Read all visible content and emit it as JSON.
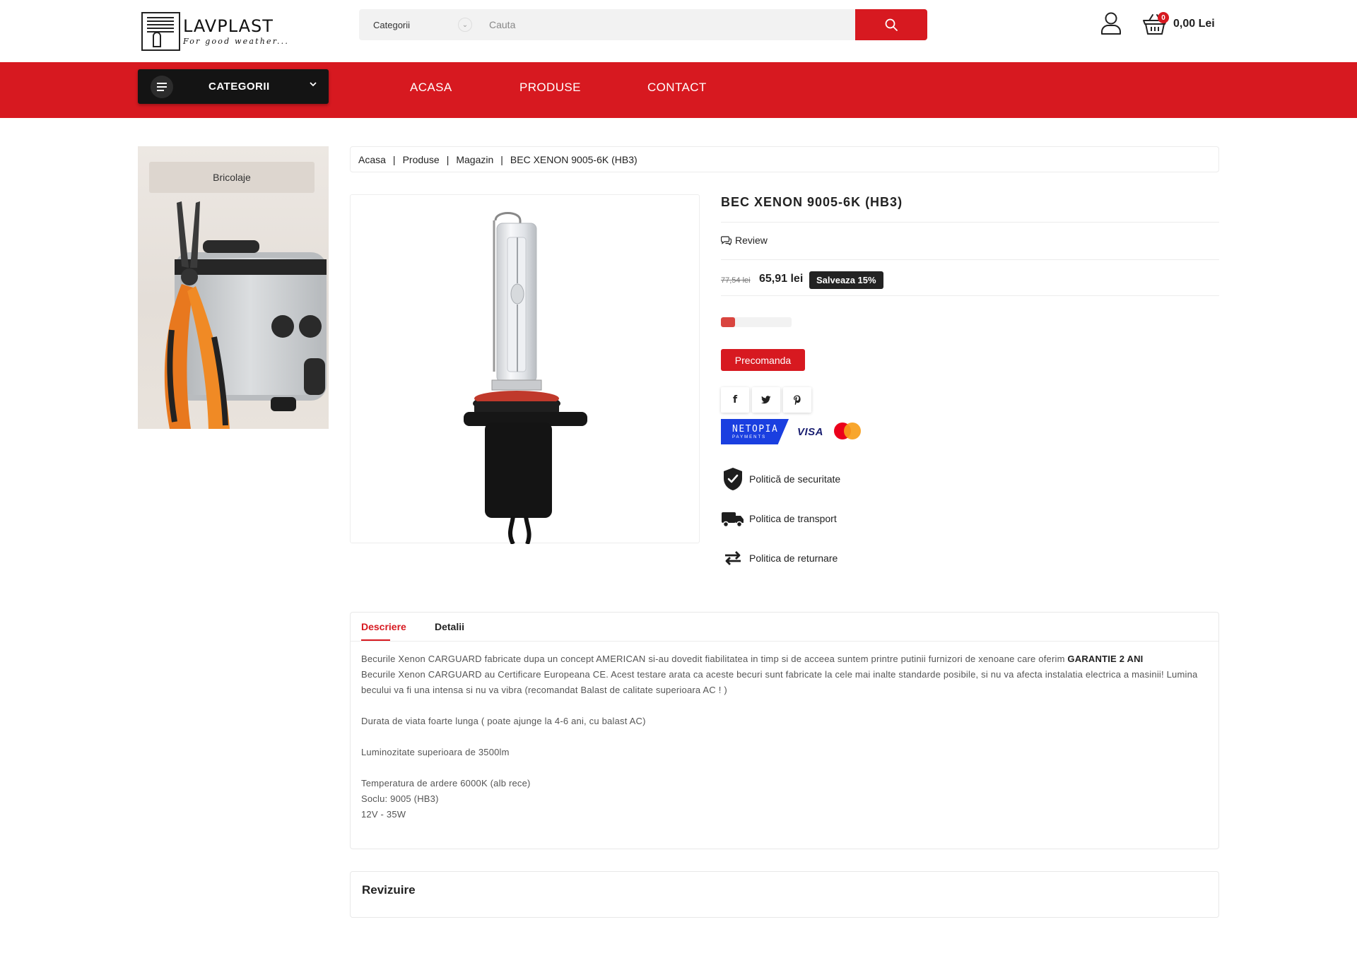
{
  "header": {
    "logo_name": "LAVPLAST",
    "logo_tagline": "For good weather...",
    "search_category": "Categorii",
    "search_placeholder": "Cauta",
    "cart_count": "0",
    "cart_total": "0,00 Lei"
  },
  "nav": {
    "categories_label": "CATEGORII",
    "links": [
      "ACASA",
      "PRODUSE",
      "CONTACT"
    ]
  },
  "sidebar": {
    "banner_label": "Bricolaje"
  },
  "breadcrumb": [
    "Acasa",
    "Produse",
    "Magazin",
    "BEC XENON 9005-6K (HB3)"
  ],
  "product": {
    "title": "BEC XENON 9005-6K (HB3)",
    "review_label": "Review",
    "old_price": "77,54 lei",
    "new_price": "65,91 lei",
    "save_badge": "Salveaza 15%",
    "stock_level": 0.2,
    "preorder_label": "Precomanda",
    "social": [
      "facebook-icon",
      "twitter-icon",
      "pinterest-icon"
    ],
    "payments": {
      "netopia": "NETOPIA",
      "netopia_sub": "PAYMENTS",
      "visa": "VISA"
    },
    "policies": [
      "Politică de securitate",
      "Politica de transport",
      "Politica de returnare"
    ]
  },
  "tabs": {
    "labels": [
      "Descriere",
      "Detalii"
    ],
    "description": {
      "p1_text": "Becurile Xenon CARGUARD fabricate dupa un concept AMERICAN si-au dovedit fiabilitatea in timp si de acceea suntem printre putinii furnizori de xenoane care oferim ",
      "p1_bold": "GARANTIE 2 ANI",
      "p2": "Becurile Xenon CARGUARD au Certificare Europeana CE. Acest testare arata ca aceste becuri sunt fabricate la cele mai inalte standarde posibile, si nu va afecta instalatia electrica a masinii! Lumina becului va fi una intensa si nu va vibra (recomandat Balast de calitate superioara AC ! )",
      "p3": "Durata de viata foarte lunga ( poate ajunge la 4-6 ani, cu balast AC)",
      "p4": "Luminozitate superioara de 3500lm",
      "p5": "Temperatura de ardere 6000K (alb rece)",
      "p6": "Soclu: 9005 (HB3)",
      "p7": "12V - 35W"
    }
  },
  "reviews": {
    "title": "Revizuire"
  },
  "colors": {
    "brand_red": "#d71920",
    "dark": "#141414"
  }
}
